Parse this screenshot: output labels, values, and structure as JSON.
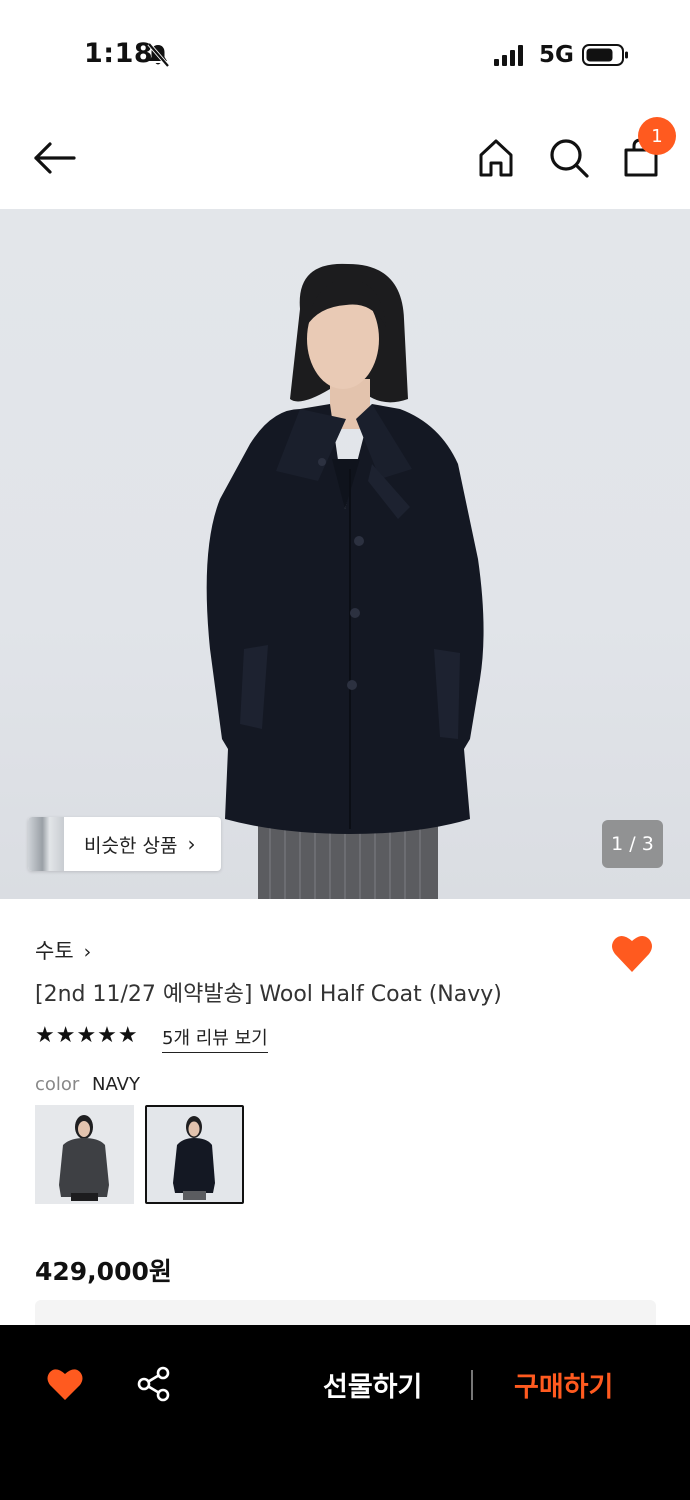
{
  "status_bar": {
    "time": "1:18",
    "network": "5G"
  },
  "nav": {
    "icons": [
      "back-arrow-icon",
      "home-icon",
      "search-icon",
      "shopping-bag-icon"
    ],
    "cart_count": "1"
  },
  "hero": {
    "similar_label": "비슷한 상품",
    "similar_chevron": "›",
    "page_indicator": "1 / 3"
  },
  "product": {
    "brand": "수토",
    "brand_chevron": "›",
    "title": "[2nd 11/27 예약발송] Wool Half Coat (Navy)",
    "rating_stars": "★★★★★",
    "rating_value": 5,
    "review_link": "5개 리뷰 보기",
    "color_label": "color",
    "color_value": "NAVY",
    "swatches": [
      "charcoal",
      "navy"
    ],
    "price": "429,000원"
  },
  "bottom_bar": {
    "gift_label": "선물하기",
    "buy_label": "구매하기"
  },
  "colors": {
    "accent": "#ff5a1f",
    "bottom_bar_bg": "#000000",
    "coat_navy": "#141823"
  }
}
